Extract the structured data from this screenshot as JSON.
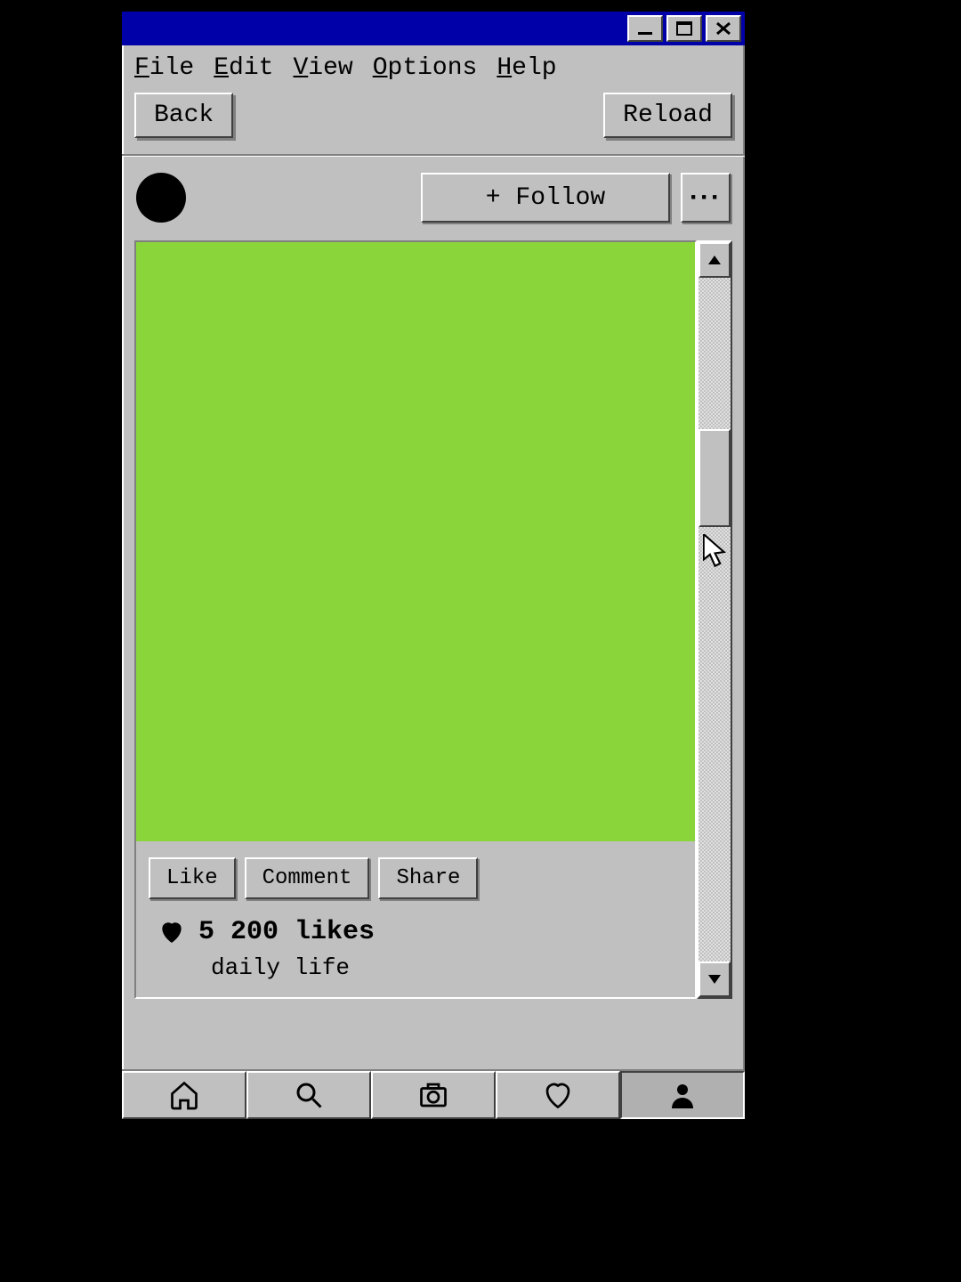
{
  "menubar": {
    "file": "File",
    "edit": "Edit",
    "view": "View",
    "options": "Options",
    "help": "Help"
  },
  "toolbar": {
    "back": "Back",
    "reload": "Reload"
  },
  "profile": {
    "follow": "+ Follow",
    "more": "···"
  },
  "post": {
    "image_color": "#8ad63a",
    "like_btn": "Like",
    "comment_btn": "Comment",
    "share_btn": "Share",
    "likes": "5 200 likes",
    "caption": "daily life"
  }
}
